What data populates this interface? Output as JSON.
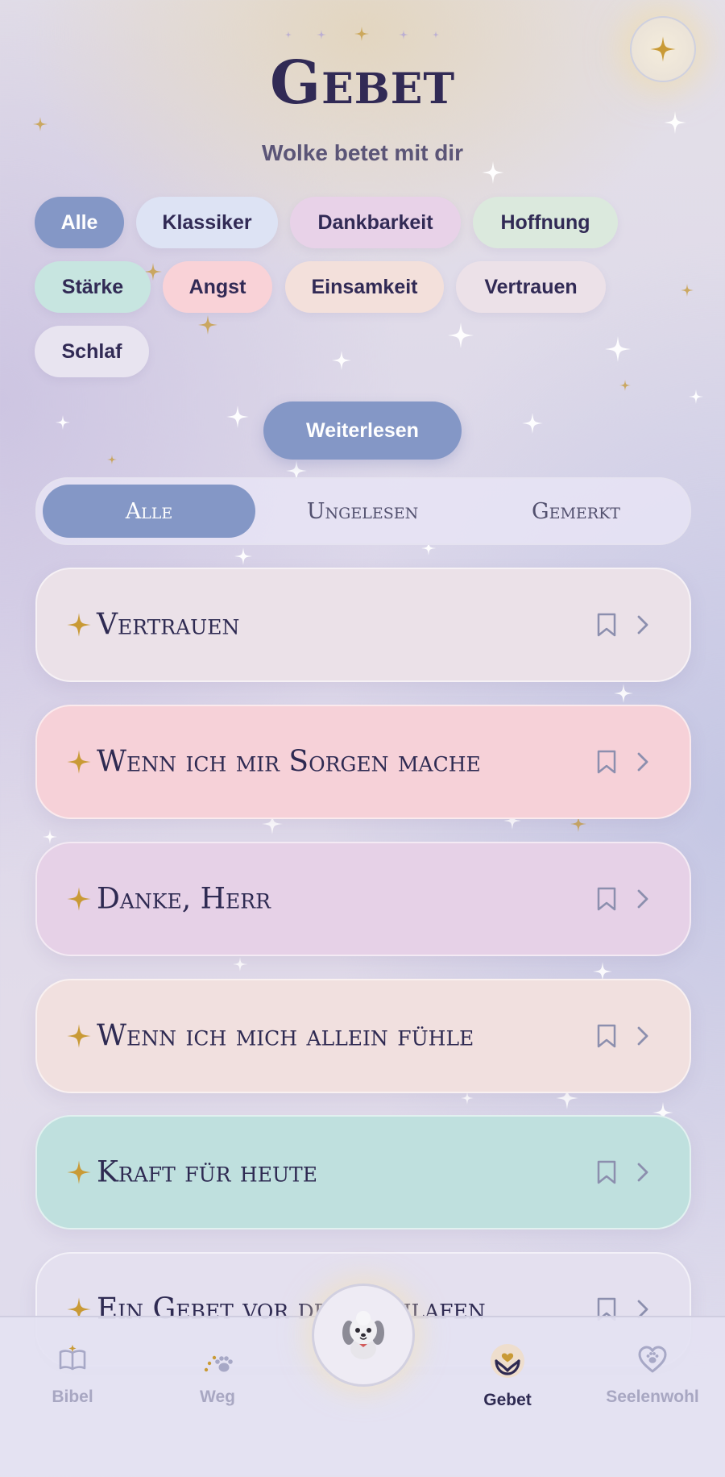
{
  "header": {
    "title": "Gebet",
    "subtitle": "Wolke betet mit dir",
    "orb_icon": "sparkle-icon"
  },
  "filters": [
    {
      "label": "Alle",
      "color": "#8497c6",
      "active": true
    },
    {
      "label": "Klassiker",
      "color": "#dde3f4"
    },
    {
      "label": "Dankbarkeit",
      "color": "#e8d2e8"
    },
    {
      "label": "Hoffnung",
      "color": "#dbe9dd"
    },
    {
      "label": "Stärke",
      "color": "#c7e5e0"
    },
    {
      "label": "Angst",
      "color": "#f9d2d7"
    },
    {
      "label": "Einsamkeit",
      "color": "#f3e0db"
    },
    {
      "label": "Vertrauen",
      "color": "#ece1e8"
    },
    {
      "label": "Schlaf",
      "color": "#e8e4f0"
    }
  ],
  "cta": {
    "label": "Weiterlesen"
  },
  "segments": [
    {
      "label": "Alle",
      "active": true
    },
    {
      "label": "Ungelesen"
    },
    {
      "label": "Gemerkt"
    }
  ],
  "prayers": [
    {
      "title": "Vertrauen",
      "color": "#ebe1e8"
    },
    {
      "title": "Wenn ich mir Sorgen mache",
      "color": "#f6d1d8"
    },
    {
      "title": "Danke, Herr",
      "color": "#e6d1e7"
    },
    {
      "title": "Wenn ich mich allein fühle",
      "color": "#f1e0df"
    },
    {
      "title": "Kraft für heute",
      "color": "#bfe0de"
    },
    {
      "title": "Ein Gebet vor dem Schlafen",
      "color": "#e4e0ef"
    }
  ],
  "nav": {
    "items": [
      {
        "label": "Bibel",
        "icon": "book-icon"
      },
      {
        "label": "Weg",
        "icon": "paw-path-icon"
      },
      {
        "label": "Gebet",
        "icon": "praying-heart-icon",
        "active": true
      },
      {
        "label": "Seelenwohl",
        "icon": "heart-paw-icon"
      }
    ],
    "center_icon": "dog-mascot-icon"
  },
  "colors": {
    "accent": "#8497c6",
    "gold": "#c89b3c",
    "ink": "#312a55"
  }
}
